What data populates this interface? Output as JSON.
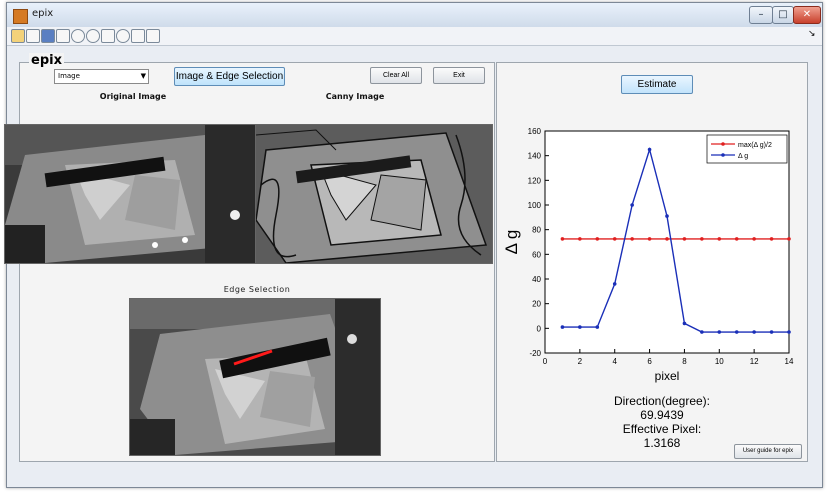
{
  "window": {
    "title": "epix",
    "buttons": [
      "–",
      "□",
      "✕"
    ]
  },
  "toolbar": {
    "icons": [
      "new-file-icon",
      "open-file-icon",
      "save-icon",
      "print-icon",
      "zoom-in-icon",
      "zoom-out-icon",
      "pan-icon",
      "rotate-icon",
      "data-cursor-icon",
      "colorbar-icon"
    ],
    "dock_arrow": "↘"
  },
  "left_panel": {
    "label": "epix",
    "dropdown_value": "Image",
    "image_edge_button": "Image & Edge Selection",
    "clear_all_button": "Clear All",
    "exit_button": "Exit",
    "original_caption": "Original Image",
    "canny_caption": "Canny Image",
    "edge_caption": "Edge Selection"
  },
  "right_panel": {
    "estimate_button": "Estimate",
    "results": {
      "direction_label": "Direction(degree):",
      "direction_value": "69.9439",
      "effective_label": "Effective Pixel:",
      "effective_value": "1.3168"
    },
    "user_guide_button": "User guide for epix"
  },
  "chart_data": {
    "type": "line",
    "xlabel": "pixel",
    "ylabel": "Δ g",
    "xlim": [
      0,
      14
    ],
    "ylim": [
      -20,
      160
    ],
    "xticks": [
      0,
      2,
      4,
      6,
      8,
      10,
      12,
      14
    ],
    "yticks": [
      -20,
      0,
      20,
      40,
      60,
      80,
      100,
      120,
      140,
      160
    ],
    "grid": true,
    "legend_position": "top-right",
    "series": [
      {
        "name": "max(Δ g)/2",
        "color": "#e02020",
        "x": [
          1,
          2,
          3,
          4,
          5,
          6,
          7,
          8,
          9,
          10,
          11,
          12,
          13,
          14
        ],
        "y": [
          72.5,
          72.5,
          72.5,
          72.5,
          72.5,
          72.5,
          72.5,
          72.5,
          72.5,
          72.5,
          72.5,
          72.5,
          72.5,
          72.5
        ]
      },
      {
        "name": "Δ g",
        "color": "#1a2fb8",
        "x": [
          1,
          2,
          3,
          4,
          5,
          6,
          7,
          8,
          9,
          10,
          11,
          12,
          13,
          14
        ],
        "y": [
          1,
          1,
          1,
          36,
          100,
          145,
          91,
          4,
          -3,
          -3,
          -3,
          -3,
          -3,
          -3
        ]
      }
    ]
  }
}
